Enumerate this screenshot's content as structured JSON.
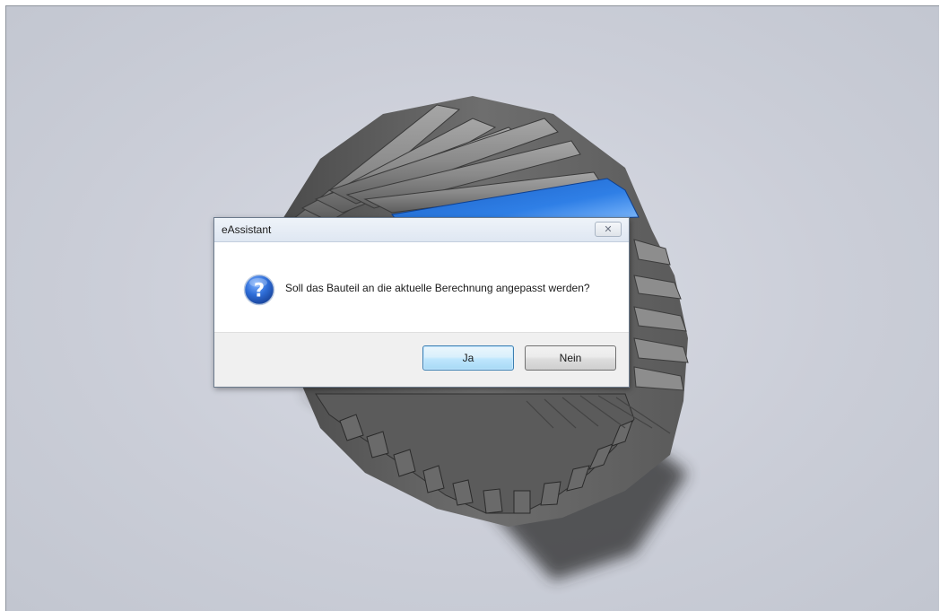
{
  "dialog": {
    "title": "eAssistant",
    "message": "Soll das Bauteil an die aktuelle Berechnung angepasst werden?",
    "yes_label": "Ja",
    "no_label": "Nein",
    "icon": "question-icon",
    "close_icon": "close-icon"
  },
  "viewport": {
    "model": "helical gear",
    "highlight_color": "#1f6fd6",
    "gear_color": "#6e6e6e",
    "background_color": "#c8cbd5"
  }
}
